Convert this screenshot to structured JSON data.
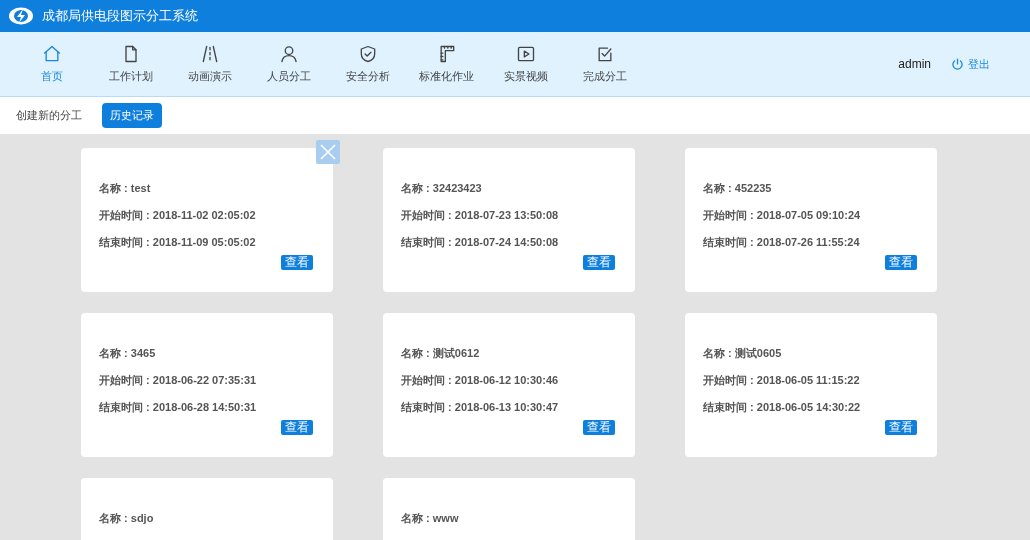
{
  "header": {
    "title": "成都局供电段图示分工系统"
  },
  "nav": [
    {
      "label": "首页",
      "selected": true
    },
    {
      "label": "工作计划",
      "selected": false
    },
    {
      "label": "动画演示",
      "selected": false
    },
    {
      "label": "人员分工",
      "selected": false
    },
    {
      "label": "安全分析",
      "selected": false
    },
    {
      "label": "标准化作业",
      "selected": false
    },
    {
      "label": "实景视频",
      "selected": false
    },
    {
      "label": "完成分工",
      "selected": false
    }
  ],
  "user": {
    "name": "admin",
    "logout": "登出"
  },
  "subtabs": [
    {
      "label": "创建新的分工",
      "selected": false
    },
    {
      "label": "历史记录",
      "selected": true
    }
  ],
  "cards": [
    {
      "lines": [
        "名称 : test",
        "开始时间 : 2018-11-02 02:05:02",
        "结束时间 : 2018-11-09 05:05:02"
      ],
      "button": "查看",
      "closable": true
    },
    {
      "lines": [
        "名称 : 32423423",
        "开始时间 : 2018-07-23 13:50:08",
        "结束时间 : 2018-07-24 14:50:08"
      ],
      "button": "查看",
      "closable": false
    },
    {
      "lines": [
        "名称 : 452235",
        "开始时间 : 2018-07-05 09:10:24",
        "结束时间 : 2018-07-26 11:55:24"
      ],
      "button": "查看",
      "closable": false
    },
    {
      "lines": [
        "名称 : 3465",
        "开始时间 : 2018-06-22 07:35:31",
        "结束时间 : 2018-06-28 14:50:31"
      ],
      "button": "查看",
      "closable": false
    },
    {
      "lines": [
        "名称 : 测试0612",
        "开始时间 : 2018-06-12 10:30:46",
        "结束时间 : 2018-06-13 10:30:47"
      ],
      "button": "查看",
      "closable": false
    },
    {
      "lines": [
        "名称 : 测试0605",
        "开始时间 : 2018-06-05 11:15:22",
        "结束时间 : 2018-06-05 14:30:22"
      ],
      "button": "查看",
      "closable": false
    },
    {
      "lines": [
        "名称 : sdjo"
      ],
      "closable": false
    },
    {
      "lines": [
        "名称 : www"
      ],
      "closable": false
    }
  ]
}
